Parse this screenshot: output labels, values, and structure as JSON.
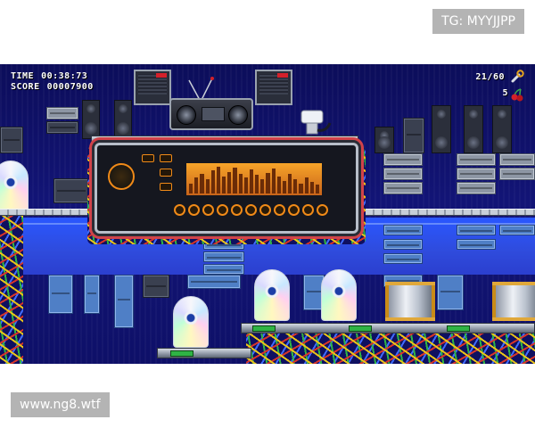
{
  "overlays": {
    "top_tag": "TG: MYYJJPP",
    "bottom_tag": "www.ng8.wtf"
  },
  "hud": {
    "time_label": "TIME",
    "time_value": "00:38:73",
    "score_label": "SCORE",
    "score_value": "00007900",
    "collectibles": "21/60",
    "lives": "5",
    "collect_icon": "wrench-icon",
    "lives_icon": "cherry-icon"
  },
  "colors": {
    "background": "#121476",
    "water": "#2f4bdc",
    "equalizer": "#f7a429",
    "accent_red": "#d4202a",
    "led_green": "#2fb345"
  },
  "equalizer": {
    "levels": [
      0.35,
      0.55,
      0.7,
      0.5,
      0.8,
      0.95,
      0.6,
      0.75,
      0.9,
      0.7,
      0.55,
      0.85,
      0.65,
      0.5,
      0.72,
      0.88,
      0.6,
      0.45,
      0.7,
      0.5,
      0.35,
      0.55,
      0.42,
      0.3
    ]
  }
}
